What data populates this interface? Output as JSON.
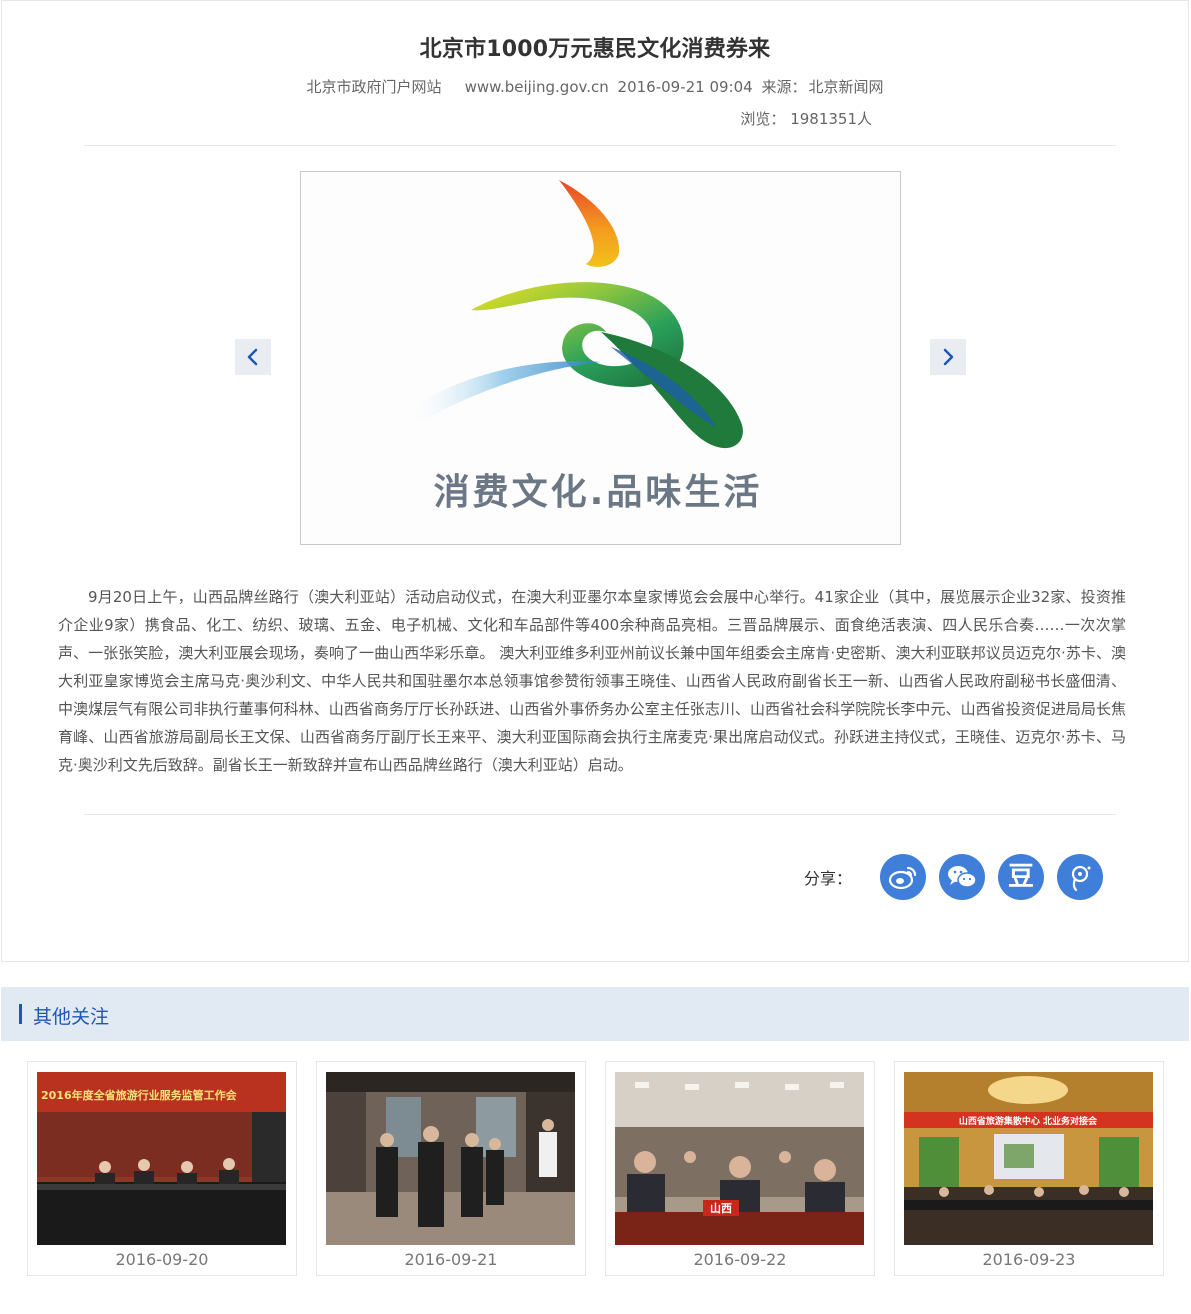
{
  "article": {
    "title": "北京市1000万元惠民文化消费券来",
    "site": "北京市政府门户网站",
    "url": "www.beijing.gov.cn",
    "datetime": "2016-09-21 09:04",
    "source_label": "来源：",
    "source": "北京新闻网",
    "views_label": "浏览：",
    "views": "1981351人",
    "slide_caption": "消费文化.品味生活",
    "body": "9月20日上午，山西品牌丝路行（澳大利亚站）活动启动仪式，在澳大利亚墨尔本皇家博览会会展中心举行。41家企业（其中，展览展示企业32家、投资推介企业9家）携食品、化工、纺织、玻璃、五金、电子机械、文化和车品部件等400余种商品亮相。三晋品牌展示、面食绝活表演、四人民乐合奏……一次次掌声、一张张笑脸，澳大利亚展会现场，奏响了一曲山西华彩乐章。 澳大利亚维多利亚州前议长兼中国年组委会主席肯·史密斯、澳大利亚联邦议员迈克尔·苏卡、澳大利亚皇家博览会主席马克·奥沙利文、中华人民共和国驻墨尔本总领事馆参赞衔领事王晓佳、山西省人民政府副省长王一新、山西省人民政府副秘书长盛佃清、中澳煤层气有限公司非执行董事何科林、山西省商务厅厅长孙跃进、山西省外事侨务办公室主任张志川、山西省社会科学院院长李中元、山西省投资促进局局长焦育峰、山西省旅游局副局长王文保、山西省商务厅副厅长王来平、澳大利亚国际商会执行主席麦克·果出席启动仪式。孙跃进主持仪式，王晓佳、迈克尔·苏卡、马克·奥沙利文先后致辞。副省长王一新致辞并宣布山西品牌丝路行（澳大利亚站）启动。"
  },
  "share": {
    "label": "分享：",
    "buttons": [
      {
        "icon": "weibo-icon"
      },
      {
        "icon": "wechat-icon"
      },
      {
        "icon": "douban-icon",
        "glyph": "豆"
      },
      {
        "icon": "tencent-weibo-icon"
      }
    ]
  },
  "other": {
    "heading": "其他关注",
    "items": [
      {
        "date": "2016-09-20",
        "banner": "2016年度全省旅游行业服务监管工作会"
      },
      {
        "date": "2016-09-21"
      },
      {
        "date": "2016-09-22",
        "sign": "山西"
      },
      {
        "date": "2016-09-23",
        "banner": "山西省旅游集散中心 北业务对接会"
      }
    ]
  },
  "colors": {
    "accent": "#1f57b5",
    "share_blue": "#3f7fd9",
    "section_bg": "#e1e9f2"
  }
}
